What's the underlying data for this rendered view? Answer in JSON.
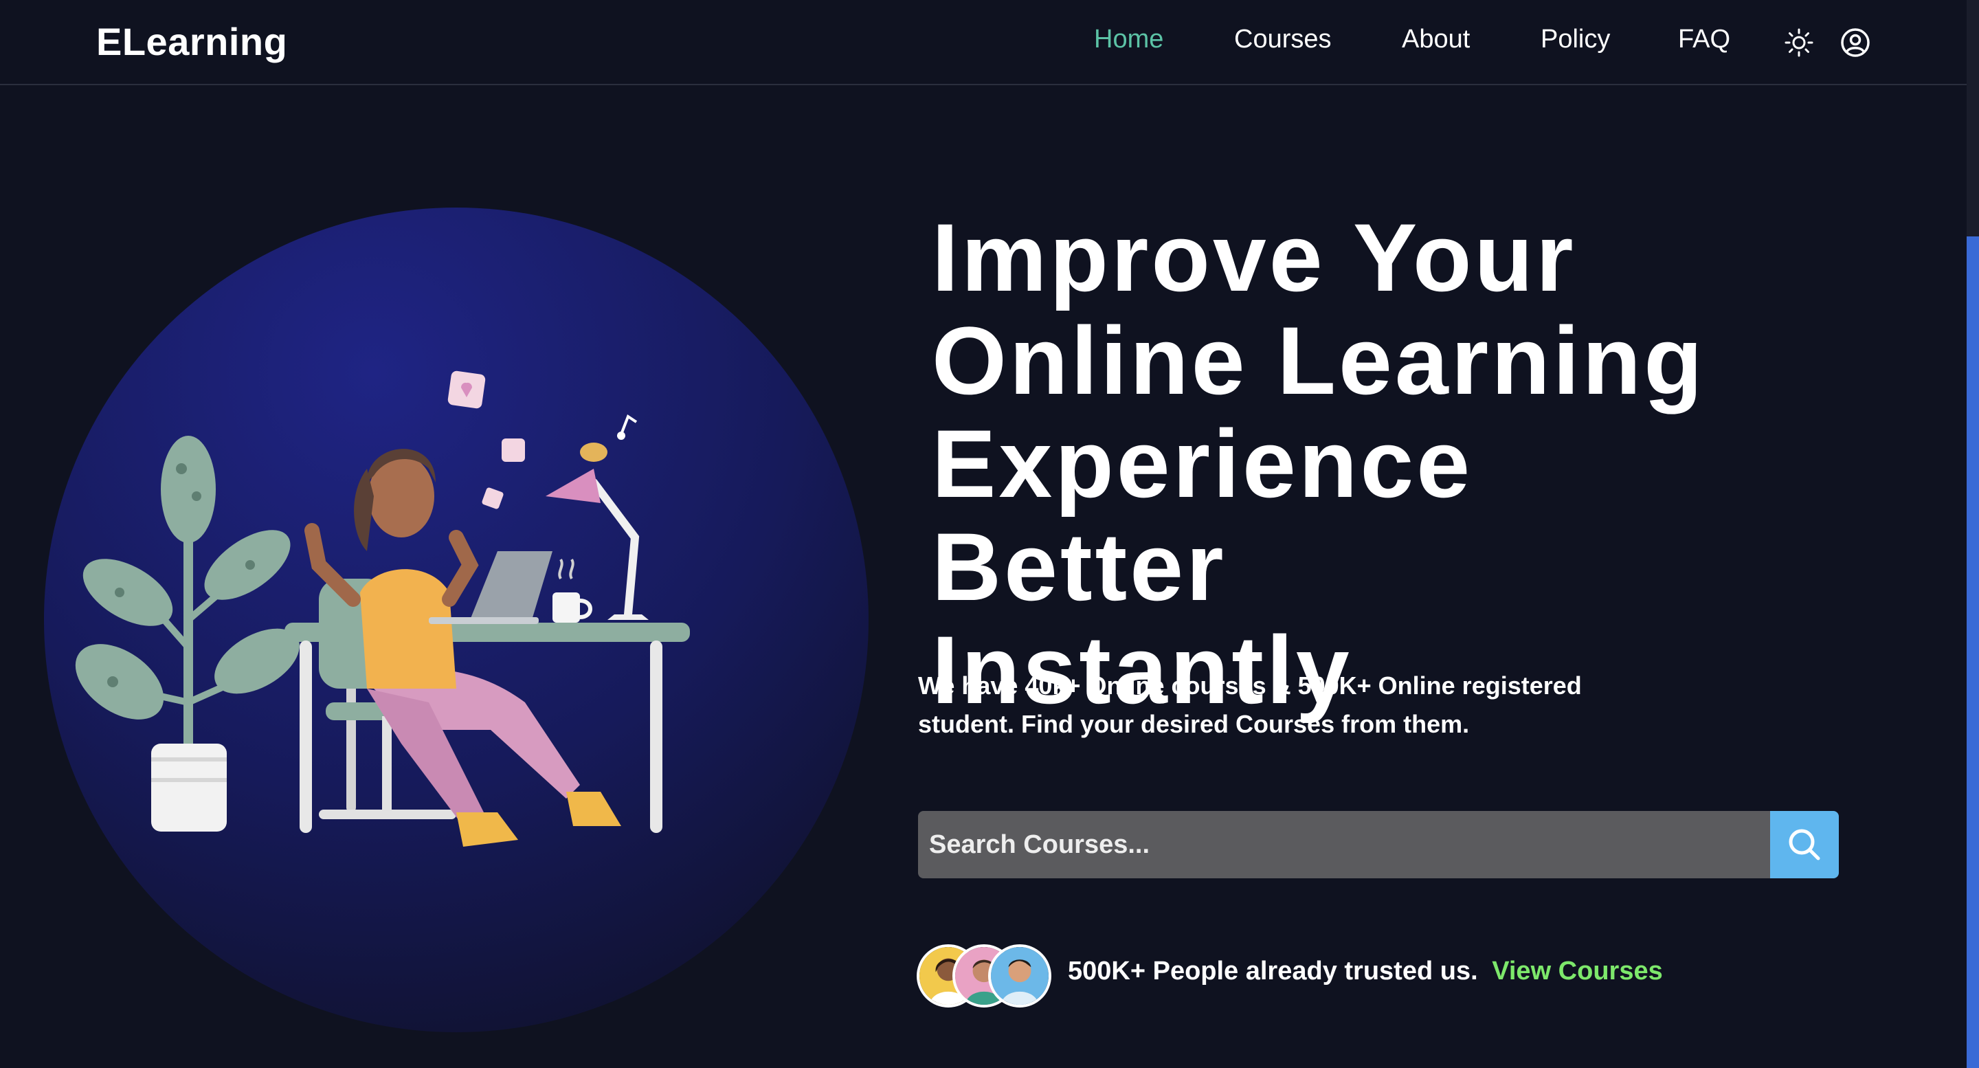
{
  "header": {
    "logo": "ELearning",
    "nav": [
      {
        "label": "Home",
        "active": true
      },
      {
        "label": "Courses",
        "active": false
      },
      {
        "label": "About",
        "active": false
      },
      {
        "label": "Policy",
        "active": false
      },
      {
        "label": "FAQ",
        "active": false
      }
    ],
    "icons": [
      "sun-icon",
      "user-circle-icon"
    ]
  },
  "hero": {
    "headline_lines": [
      "Improve Your",
      "Online Learning",
      "Experience Better",
      "Instantly"
    ],
    "subtext_line1": "We have 40k+ Online courses & 500K+ Online registered",
    "subtext_line2": "student. Find your desired Courses from them.",
    "search": {
      "placeholder": "Search Courses...",
      "value": "",
      "button_icon": "search-icon"
    },
    "trust_text": "500K+ People already trusted us.",
    "trust_link": "View Courses"
  },
  "colors": {
    "background": "#0f1220",
    "accent_nav": "#5cc3a6",
    "search_button": "#5fb6ee",
    "link": "#7de86b",
    "circle": "#1d2070"
  }
}
